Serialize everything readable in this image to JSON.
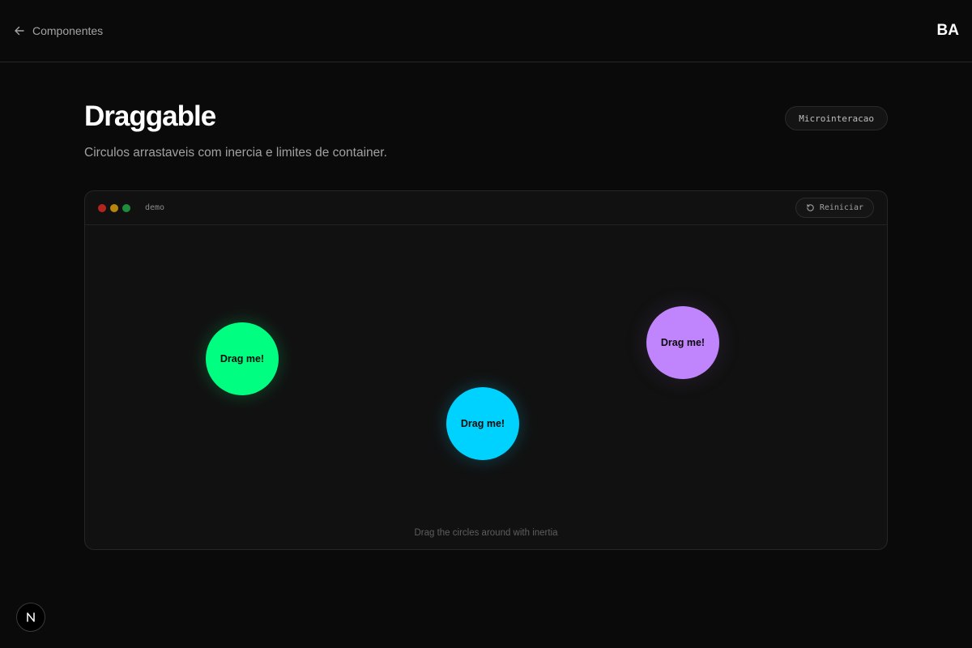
{
  "topbar": {
    "back_label": "Componentes",
    "logo": "BA"
  },
  "header": {
    "title": "Draggable",
    "subtitle": "Circulos arrastaveis com inercia e limites de container.",
    "badge": "Microinteracao"
  },
  "demo": {
    "label": "demo",
    "reset_label": "Reiniciar",
    "hint": "Drag the circles around with inertia",
    "circles": [
      {
        "label": "Drag me!",
        "color": "#00ff80"
      },
      {
        "label": "Drag me!",
        "color": "#00d2ff"
      },
      {
        "label": "Drag me!",
        "color": "#c084fc"
      }
    ]
  },
  "colors": {
    "background": "#0a0a0a",
    "panel": "#111111",
    "border": "#262626"
  }
}
